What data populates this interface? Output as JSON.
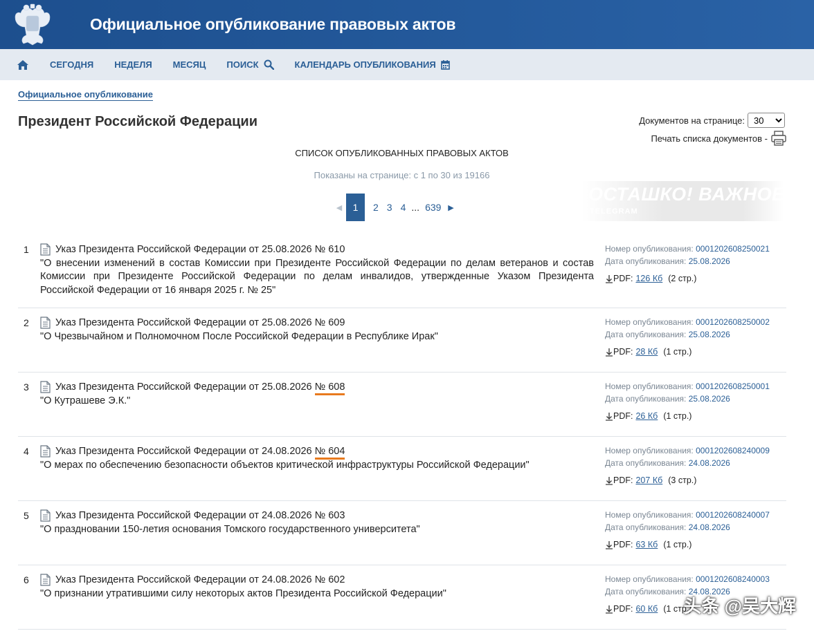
{
  "header": {
    "title": "Официальное опубликование правовых актов"
  },
  "nav": {
    "items": [
      {
        "label": "СЕГОДНЯ"
      },
      {
        "label": "НЕДЕЛЯ"
      },
      {
        "label": "МЕСЯЦ"
      },
      {
        "label": "ПОИСК"
      },
      {
        "label": "КАЛЕНДАРЬ ОПУБЛИКОВАНИЯ"
      }
    ]
  },
  "breadcrumb": "Официальное опубликование",
  "page_title": "Президент Российской Федерации",
  "per_page": {
    "label": "Документов на странице:",
    "value": "30"
  },
  "print_label": "Печать списка документов -",
  "list_title": "СПИСОК ОПУБЛИКОВАННЫХ ПРАВОВЫХ АКТОВ",
  "shown_text": "Показаны на странице: с 1 по 30 из 19166",
  "pager": {
    "current": "1",
    "pages": [
      "2",
      "3",
      "4"
    ],
    "dots": "...",
    "last": "639"
  },
  "watermark": {
    "line1": "ОСТАШКО! ВАЖНОЕ",
    "line2": "TELEGRAM"
  },
  "meta_labels": {
    "number": "Номер опубликования:",
    "date": "Дата опубликования:",
    "pdf": "PDF:"
  },
  "documents": [
    {
      "num": "1",
      "title_prefix": "Указ Президента Российской Федерации от 25.08.2026 ",
      "title_no": "№ 610",
      "desc": "\"О внесении изменений в состав Комиссии при Президенте Российской Федерации по делам ветеранов и состав Комиссии при Президенте Российской Федерации по делам инвалидов, утвержденные Указом Президента Российской Федерации от 16 января 2025 г. № 25\"",
      "pub_number": "0001202608250021",
      "pub_date": "25.08.2026",
      "pdf_size": "126 Кб",
      "pages": "(2 стр.)"
    },
    {
      "num": "2",
      "title_prefix": "Указ Президента Российской Федерации от 25.08.2026 ",
      "title_no": "№ 609",
      "desc": "\"О Чрезвычайном и Полномочном После Российской Федерации в Республике Ирак\"",
      "pub_number": "0001202608250002",
      "pub_date": "25.08.2026",
      "pdf_size": "28 Кб",
      "pages": "(1 стр.)"
    },
    {
      "num": "3",
      "title_prefix": "Указ Президента Российской Федерации от 25.08.2026 ",
      "title_no": "№ 608",
      "desc": "\"О Кутрашеве Э.К.\"",
      "pub_number": "0001202608250001",
      "pub_date": "25.08.2026",
      "pdf_size": "26 Кб",
      "pages": "(1 стр.)"
    },
    {
      "num": "4",
      "title_prefix": "Указ Президента Российской Федерации от 24.08.2026 ",
      "title_no": "№ 604",
      "desc": "\"О мерах по обеспечению безопасности объектов критической инфраструктуры Российской Федерации\"",
      "pub_number": "0001202608240009",
      "pub_date": "24.08.2026",
      "pdf_size": "207 Кб",
      "pages": "(3 стр.)"
    },
    {
      "num": "5",
      "title_prefix": "Указ Президента Российской Федерации от 24.08.2026 ",
      "title_no": "№ 603",
      "desc": "\"О праздновании 150-летия основания Томского государственного университета\"",
      "pub_number": "0001202608240007",
      "pub_date": "24.08.2026",
      "pdf_size": "63 Кб",
      "pages": "(1 стр.)"
    },
    {
      "num": "6",
      "title_prefix": "Указ Президента Российской Федерации от 24.08.2026 ",
      "title_no": "№ 602",
      "desc": "\"О признании утратившими силу некоторых актов Президента Российской Федерации\"",
      "pub_number": "0001202608240003",
      "pub_date": "24.08.2026",
      "pdf_size": "60 Кб",
      "pages": "(1 стр.)"
    }
  ],
  "overlay_watermark": "头条 @吴大辉"
}
